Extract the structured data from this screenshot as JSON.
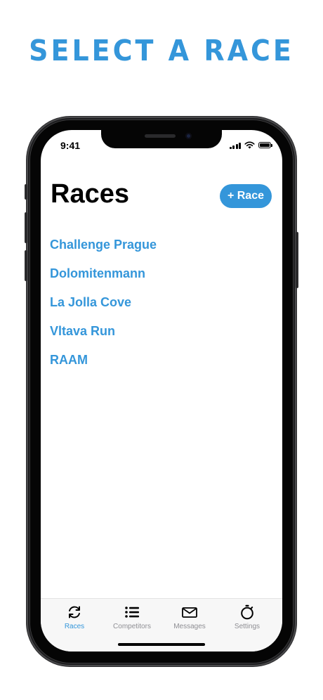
{
  "headline": "SELECT A RACE",
  "status_bar": {
    "time": "9:41"
  },
  "header": {
    "title": "Races",
    "add_button_label": "+ Race"
  },
  "races": [
    "Challenge Prague",
    "Dolomitenmann",
    "La Jolla Cove",
    "Vltava Run",
    "RAAM"
  ],
  "tab_bar": {
    "tabs": [
      {
        "label": "Races",
        "icon": "refresh-icon",
        "active": true
      },
      {
        "label": "Competitors",
        "icon": "list-icon",
        "active": false
      },
      {
        "label": "Messages",
        "icon": "envelope-icon",
        "active": false
      },
      {
        "label": "Settings",
        "icon": "stopwatch-icon",
        "active": false
      }
    ]
  },
  "colors": {
    "accent": "#3496da",
    "inactive": "#8e8e93"
  }
}
